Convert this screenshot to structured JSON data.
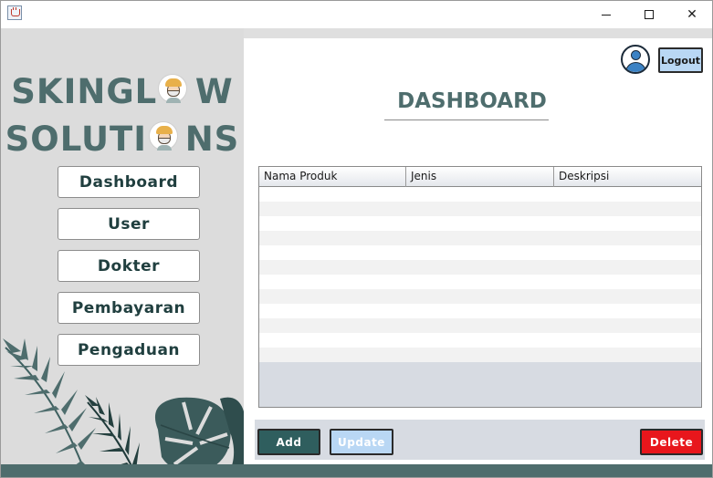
{
  "window": {
    "title": "",
    "controls": {
      "minimize": "minimize-icon",
      "maximize": "maximize-icon",
      "close": "close-icon"
    }
  },
  "brand": {
    "line1": "SKINGL   W",
    "line2": "SOLUTI   NS",
    "color": "#4e6d6d"
  },
  "sidebar": {
    "items": [
      {
        "label": "Dashboard"
      },
      {
        "label": "User"
      },
      {
        "label": "Dokter"
      },
      {
        "label": "Pembayaran"
      },
      {
        "label": "Pengaduan"
      }
    ]
  },
  "header": {
    "logout_label": "Logout",
    "title": "DASHBOARD"
  },
  "table": {
    "columns": [
      "Nama Produk",
      "Jenis",
      "Deskripsi"
    ],
    "rows": []
  },
  "actions": {
    "add_label": "Add",
    "update_label": "Update",
    "delete_label": "Delete"
  },
  "colors": {
    "accent": "#4e6d6d",
    "add": "#2f5e5e",
    "update": "#b9d7f4",
    "delete": "#e8161c"
  }
}
